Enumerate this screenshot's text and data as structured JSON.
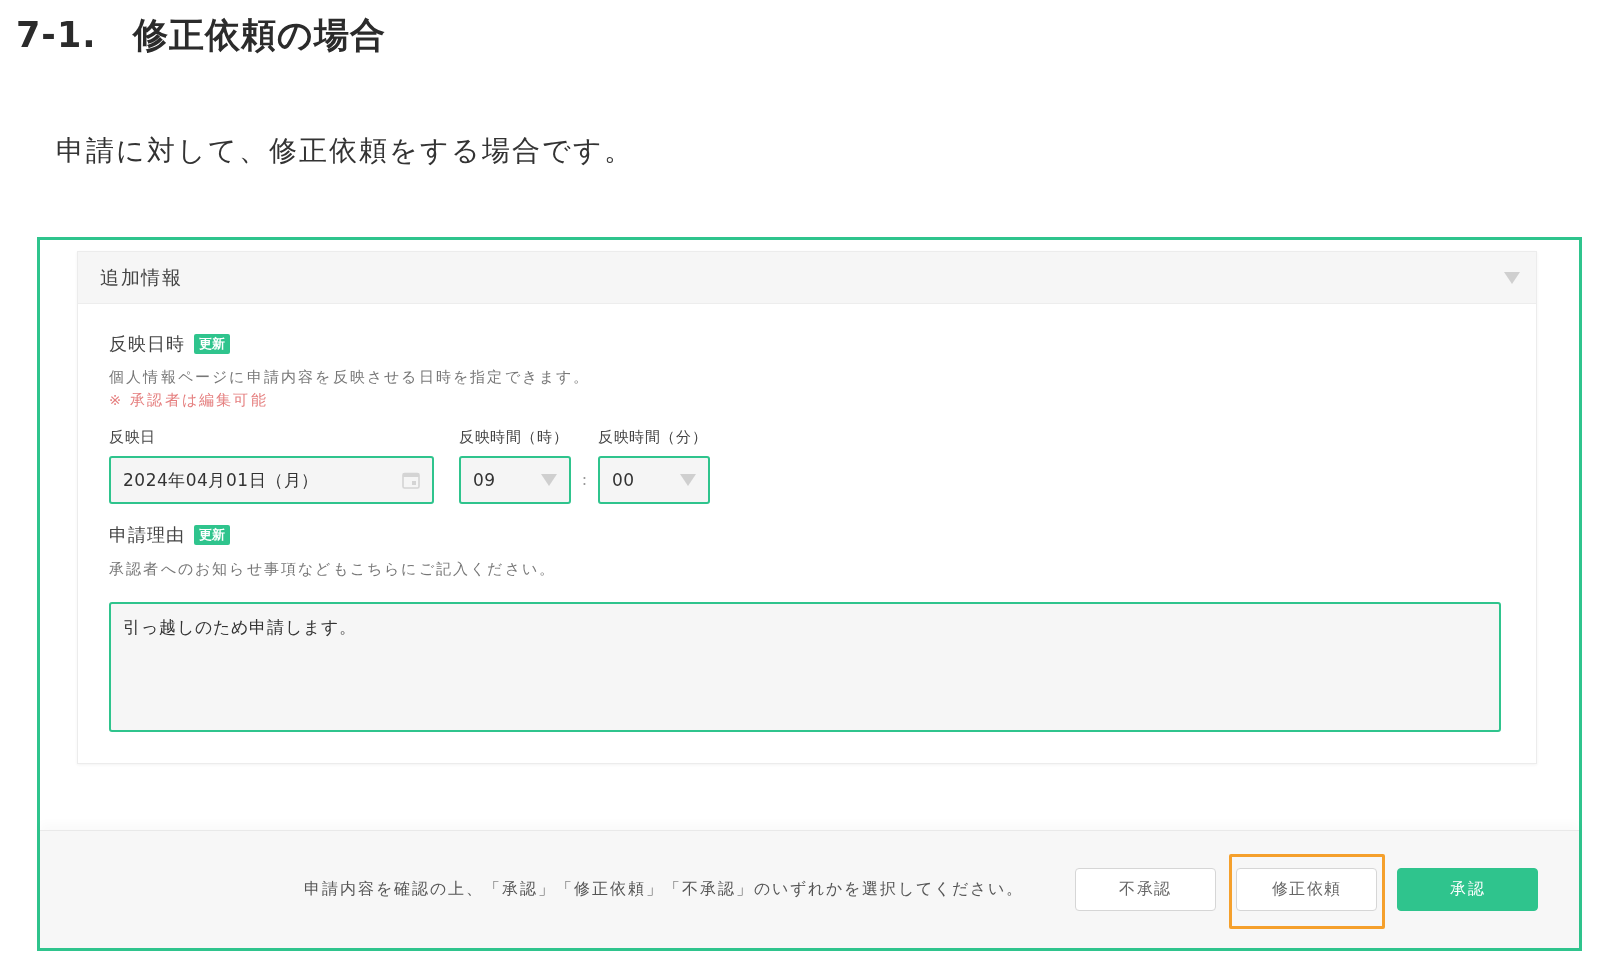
{
  "heading": "7-1.　修正依頼の場合",
  "intro": "申請に対して、修正依頼をする場合です。",
  "panel": {
    "title": "追加情報",
    "expanded": true,
    "reflect": {
      "label": "反映日時",
      "badge": "更新",
      "description": "個人情報ページに申請内容を反映させる日時を指定できます。",
      "note": "※ 承認者は編集可能",
      "time_separator": ":",
      "fields": [
        {
          "kind": "date",
          "label": "反映日",
          "value": "2024年04月01日（月）"
        },
        {
          "kind": "select",
          "label": "反映時間（時）",
          "value": "09"
        },
        {
          "kind": "select",
          "label": "反映時間（分）",
          "value": "00"
        }
      ]
    },
    "reason": {
      "label": "申請理由",
      "badge": "更新",
      "description": "承認者へのお知らせ事項などもこちらにご記入ください。",
      "value": "引っ越しのため申請します。"
    }
  },
  "footer": {
    "message": "申請内容を確認の上、「承認」「修正依頼」「不承認」のいずれかを選択してください。",
    "buttons": [
      {
        "label": "不承認",
        "kind": "secondary",
        "highlighted": false
      },
      {
        "label": "修正依頼",
        "kind": "secondary",
        "highlighted": true
      },
      {
        "label": "承認",
        "kind": "primary",
        "highlighted": false
      }
    ]
  }
}
